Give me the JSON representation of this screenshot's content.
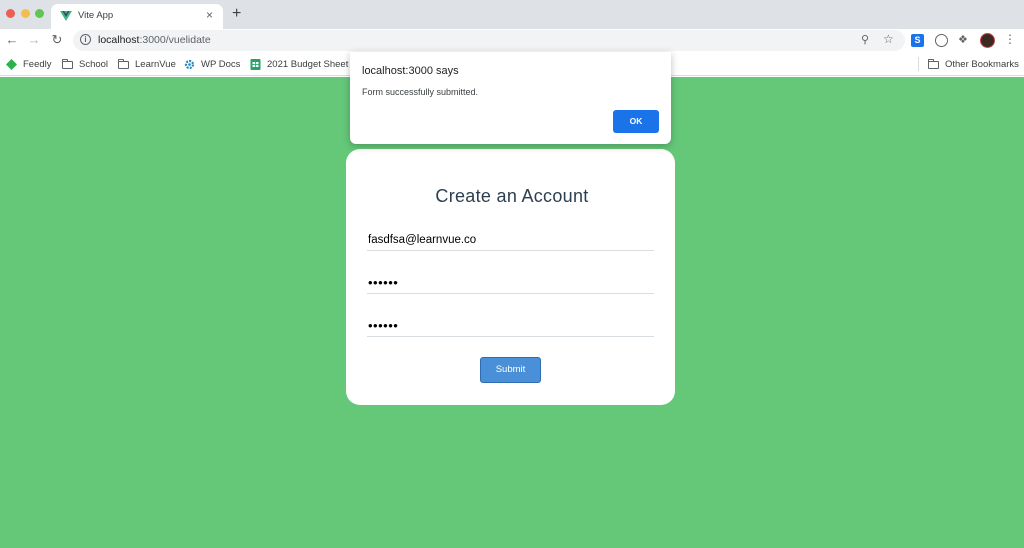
{
  "browser": {
    "tab_title": "Vite App",
    "tab_close": "×",
    "new_tab": "+",
    "url_host": "localhost",
    "url_path": ":3000/vuelidate",
    "extension_s_label": "S",
    "bookmarks": [
      {
        "label": "Feedly",
        "icon": "feedly-icon"
      },
      {
        "label": "School",
        "icon": "folder-icon"
      },
      {
        "label": "LearnVue",
        "icon": "folder-icon"
      },
      {
        "label": "WP Docs",
        "icon": "gear-icon"
      },
      {
        "label": "2021 Budget Sheet",
        "icon": "sheets-icon"
      }
    ],
    "other_bookmarks": "Other Bookmarks"
  },
  "dialog": {
    "title": "localhost:3000 says",
    "message": "Form successfully submitted.",
    "ok_label": "OK"
  },
  "form": {
    "title": "Create an Account",
    "email_value": "fasdfsa@learnvue.co",
    "password_value": "123456",
    "confirm_password_value": "123456",
    "submit_label": "Submit"
  },
  "colors": {
    "page_background": "#64c878",
    "title_text": "#2c3e50",
    "submit_button": "#4a90d9",
    "dialog_ok": "#1a73e8"
  }
}
